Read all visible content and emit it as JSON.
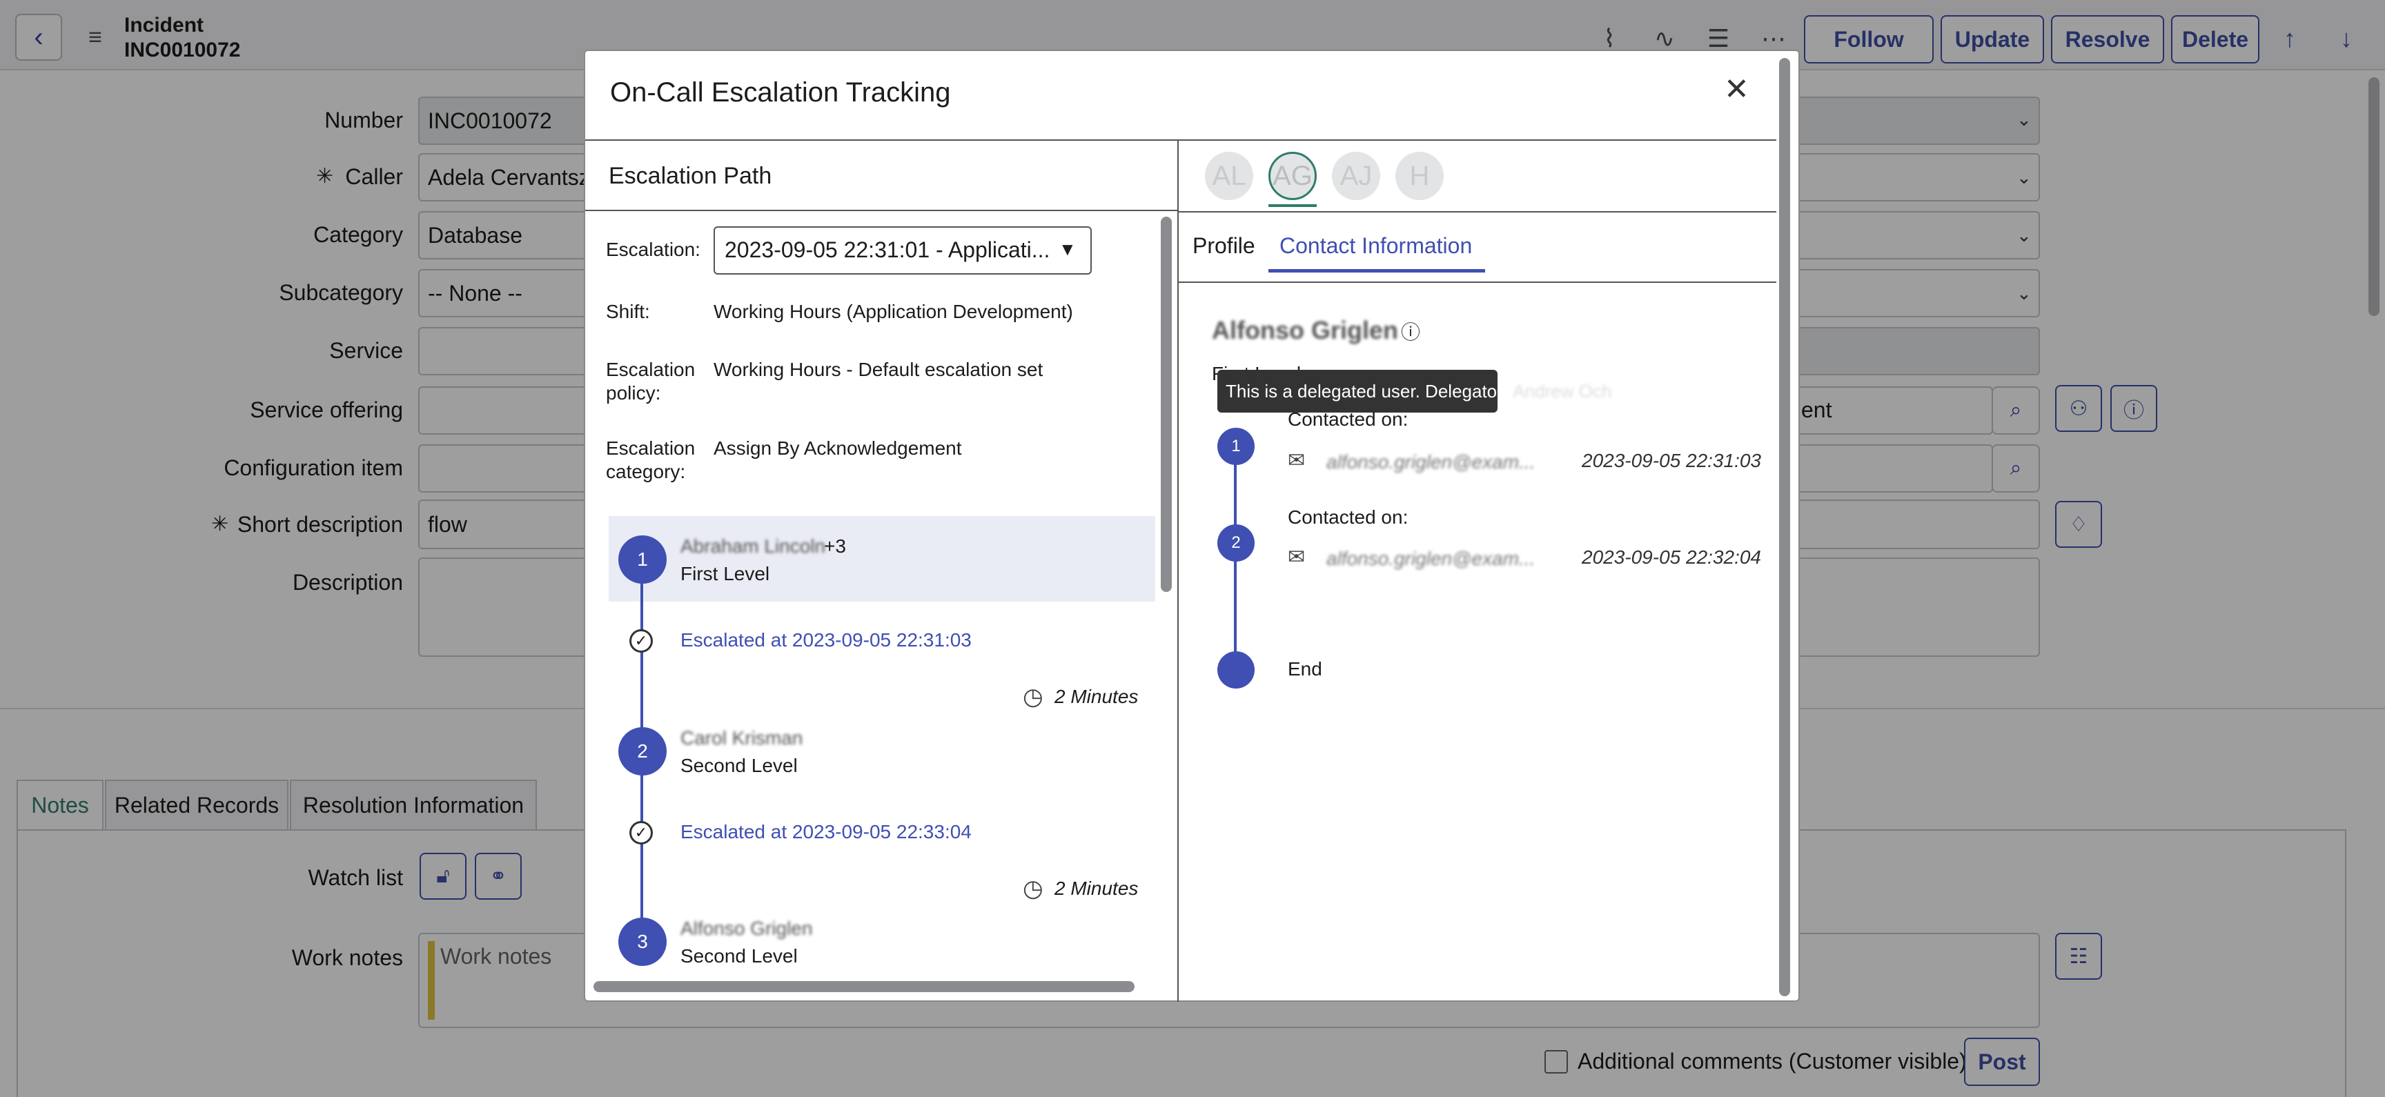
{
  "header": {
    "record_type": "Incident",
    "record_number": "INC0010072",
    "buttons": {
      "follow": "Follow",
      "update": "Update",
      "resolve": "Resolve",
      "delete": "Delete"
    }
  },
  "form": {
    "fields": {
      "number": {
        "label": "Number",
        "value": "INC0010072"
      },
      "caller": {
        "label": "Caller",
        "value": "Adela Cervantsz"
      },
      "category": {
        "label": "Category",
        "value": "Database"
      },
      "subcategory": {
        "label": "Subcategory",
        "value": "-- None --"
      },
      "service": {
        "label": "Service",
        "value": ""
      },
      "service_offering": {
        "label": "Service offering",
        "value": ""
      },
      "configuration_item": {
        "label": "Configuration item",
        "value": ""
      },
      "short_description": {
        "label": "Short description",
        "value": "flow"
      },
      "description": {
        "label": "Description",
        "value": ""
      }
    },
    "right_partial": {
      "assignment_fragment": "ent"
    },
    "required_mark": "✳"
  },
  "bottom": {
    "tabs": [
      "Notes",
      "Related Records",
      "Resolution Information"
    ],
    "watch_list_label": "Watch list",
    "work_notes_label": "Work notes",
    "work_notes_placeholder": "Work notes",
    "additional_comments_label": "Additional comments (Customer visible)",
    "post_button": "Post"
  },
  "modal": {
    "title": "On-Call Escalation Tracking",
    "left": {
      "section_title": "Escalation Path",
      "escalation_label": "Escalation:",
      "escalation_value": "2023-09-05 22:31:01 - Applicati...",
      "shift_label": "Shift:",
      "shift_value": "Working Hours (Application Development)",
      "policy_label_1": "Escalation",
      "policy_label_2": "policy:",
      "policy_value": "Working Hours - Default escalation set",
      "category_label_1": "Escalation",
      "category_label_2": "category:",
      "category_value": "Assign By Acknowledgement",
      "levels": [
        {
          "num": "1",
          "name": "Abraham Lincoln",
          "extra": "+3",
          "level": "First Level",
          "escalated": "Escalated at 2023-09-05 22:31:03",
          "duration": "2 Minutes"
        },
        {
          "num": "2",
          "name": "Carol Krisman",
          "extra": "",
          "level": "Second Level",
          "escalated": "Escalated at 2023-09-05 22:33:04",
          "duration": "2 Minutes"
        },
        {
          "num": "3",
          "name": "Alfonso Griglen",
          "extra": "",
          "level": "Second Level"
        }
      ]
    },
    "right": {
      "avatars": [
        "AL",
        "AG",
        "AJ",
        "H"
      ],
      "tabs": {
        "profile": "Profile",
        "contact": "Contact Information"
      },
      "person_name": "Alfonso Griglen",
      "person_level": "First Level",
      "tooltip_prefix": "This is a delegated user. Delegator:",
      "tooltip_delegator": "Andrew Och",
      "contacts": [
        {
          "num": "1",
          "label": "Contacted on:",
          "email": "alfonso.griglen@exam...",
          "time": "2023-09-05 22:31:03"
        },
        {
          "num": "2",
          "label": "Contacted on:",
          "email": "alfonso.griglen@exam...",
          "time": "2023-09-05 22:32:04"
        }
      ],
      "end_label": "End"
    }
  },
  "colors": {
    "accent": "#3f4fb2",
    "link": "#3f4fb2",
    "work_notes_bar": "#e1c340"
  }
}
